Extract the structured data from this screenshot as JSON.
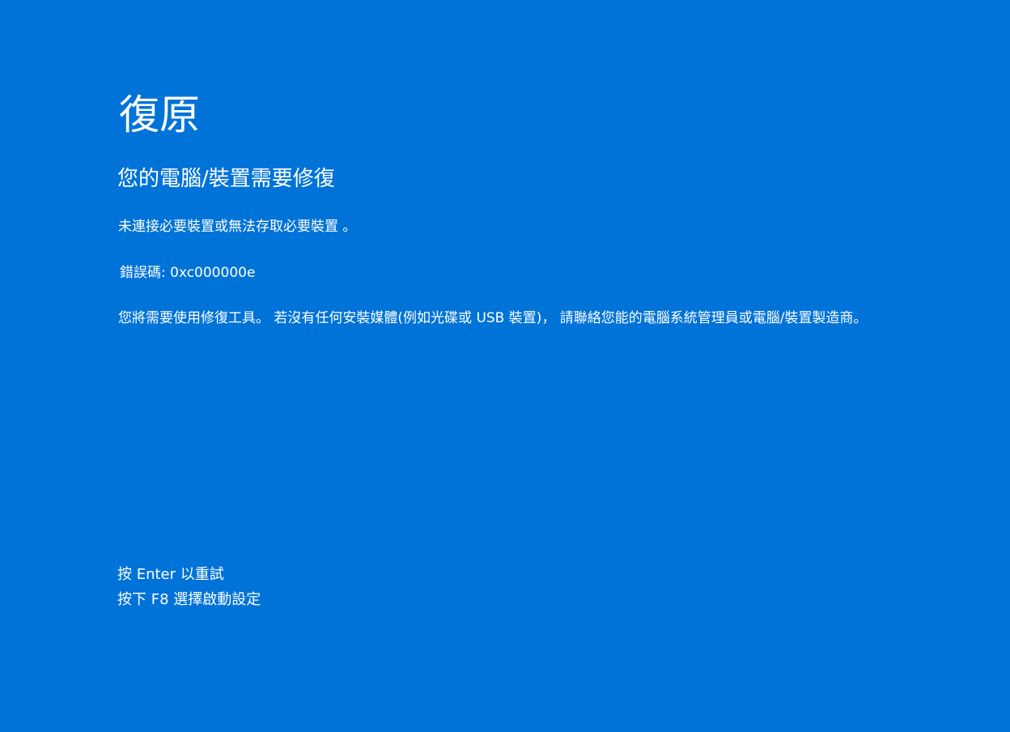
{
  "background_color": "#0073d9",
  "text_color": "#ffffff",
  "title": "復原",
  "subtitle": "您的電腦/裝置需要修復",
  "message": "未連接必要裝置或無法存取必要裝置 。",
  "error_code_line": "錯誤碼: 0xc000000e",
  "instructions": "您將需要使用修復工具。 若沒有任何安裝媒體(例如光碟或 USB 裝置)， 請聯絡您能的電腦系統管理員或電腦/裝置製造商。",
  "footer": {
    "enter_hint": "按 Enter 以重試",
    "f8_hint": "按下 F8 選擇啟動設定"
  }
}
